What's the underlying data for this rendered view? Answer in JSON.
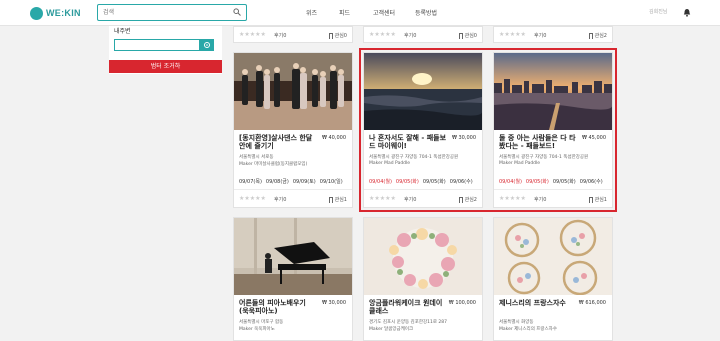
{
  "header": {
    "logo_text": "WE:KIN",
    "search_placeholder": "검색",
    "nav": [
      "위즈",
      "피드",
      "고객센터",
      "등록방법"
    ],
    "user_name": "김희진님"
  },
  "sidebar": {
    "label": "내주변",
    "button_label": "범터 조거하"
  },
  "row0": [
    {
      "reviews": "후기0",
      "fav": "관심0"
    },
    {
      "reviews": "후기0",
      "fav": "관심0"
    },
    {
      "reviews": "후기0",
      "fav": "관심2"
    }
  ],
  "cards": [
    {
      "title": "[동지환영]살사댄스 한달안에 즐기기",
      "price": "₩ 40,000",
      "addr": "서울특별시 서로동",
      "maker": "Maker 마미살사클럽(동지클럽모임)",
      "dates": [
        "09/07(목)",
        "09/08(금)",
        "09/09(토)",
        "09/10(일)"
      ],
      "red_dates": 0,
      "reviews": "후기0",
      "fav": "관심1"
    },
    {
      "title": "나 혼자서도 잘해 - 패들보드 마이웨이!",
      "price": "₩ 30,000",
      "addr": "서울특별시 광진구 자양동 704-1 뚝섬한강공원",
      "maker": "Maker Mad Paddle",
      "dates": [
        "09/04(월)",
        "09/05(화)",
        "09/05(화)",
        "09/06(수)"
      ],
      "red_dates": 2,
      "reviews": "후기0",
      "fav": "관심2"
    },
    {
      "title": "둘 중 아는 사람들은 다 타봤다는 - 패들보드!",
      "price": "₩ 45,000",
      "addr": "서울특별시 광진구 자양동 704-1 뚝섬한강공원",
      "maker": "Maker Mad Paddle",
      "dates": [
        "09/04(월)",
        "09/05(화)",
        "09/05(화)",
        "09/06(수)"
      ],
      "red_dates": 2,
      "reviews": "후기0",
      "fav": "관심1"
    },
    {
      "title": "어른들의 피아노배우기 (욱욱피아노)",
      "price": "₩ 30,000",
      "addr": "서울특별시 마포구 합동",
      "maker": "Maker 욱욱피아노",
      "dates": [],
      "red_dates": 0,
      "reviews": "",
      "fav": ""
    },
    {
      "title": "앙금플라워케이크 원데이 클래스",
      "price": "₩ 100,000",
      "addr": "경기도 김포시 운양동 김포한강11로 287",
      "maker": "Maker 달콤앙금케이크",
      "dates": [],
      "red_dates": 0,
      "reviews": "",
      "fav": ""
    },
    {
      "title": "제니스리의 프랑스자수",
      "price": "₩ 616,000",
      "addr": "서울특별시 화양동",
      "maker": "Maker 제니스리의 프랑스자수",
      "dates": [],
      "red_dates": 0,
      "reviews": "",
      "fav": ""
    }
  ],
  "stars": "★★★★★",
  "colors": {
    "accent": "#29a8a8",
    "highlight": "#d8262f"
  }
}
